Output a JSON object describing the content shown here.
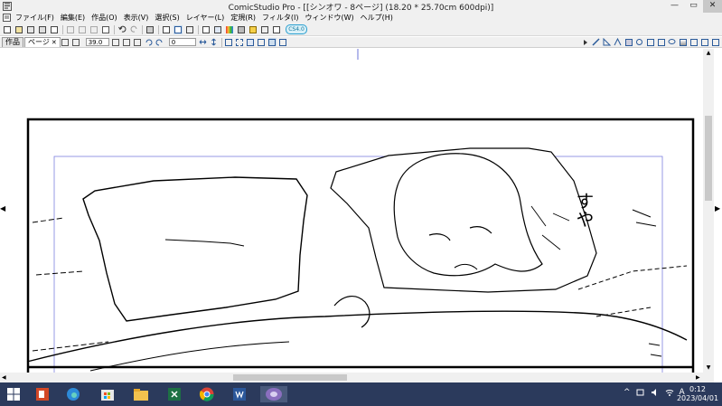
{
  "window": {
    "title": "ComicStudio Pro - [[シンオワ - 8ページ] (18.20 * 25.70cm 600dpi)]",
    "controls": {
      "minimize": "—",
      "restore": "▭",
      "close": "✕"
    }
  },
  "menu": {
    "items": [
      "ファイル(F)",
      "編集(E)",
      "作品(O)",
      "表示(V)",
      "選択(S)",
      "レイヤー(L)",
      "定規(R)",
      "フィルタ(I)",
      "ウィンドウ(W)",
      "ヘルプ(H)"
    ]
  },
  "toolbar": {
    "icons": [
      "new-icon",
      "open-icon",
      "save-icon",
      "save-as-icon",
      "print-setup-icon",
      "cut-icon",
      "copy-icon",
      "paste-icon",
      "delete-icon",
      "undo-icon",
      "redo-icon",
      "print-icon",
      "page-view-icon",
      "spread-view-icon",
      "book-icon",
      "layer-props-icon",
      "navigator-icon",
      "color-palette-icon",
      "tone-icon",
      "pen-icon",
      "settings-icon",
      "info-icon"
    ],
    "badge_label": "CS4.0"
  },
  "secondary_toolbar": {
    "tabs": [
      {
        "label": "作品",
        "active": false
      },
      {
        "label": "ページ",
        "active": true,
        "close": "✕"
      }
    ],
    "zoom_value": "39.0",
    "rotation_value": "0"
  },
  "canvas": {
    "sound_effect": "すや",
    "scroll_left_arrow": "◀",
    "scroll_right_arrow": "▶"
  },
  "scrollbars": {
    "up": "▲",
    "down": "▼",
    "left": "◀",
    "right": "▶"
  },
  "taskbar": {
    "apps": [
      "start-icon",
      "powerpoint-icon",
      "edge-icon",
      "store-icon",
      "explorer-icon",
      "excel-icon",
      "chrome-icon",
      "word-icon",
      "comicstudio-icon"
    ],
    "tray": {
      "chevron": "^",
      "ime": "A"
    },
    "time": "0:12",
    "date": "2023/04/01"
  }
}
